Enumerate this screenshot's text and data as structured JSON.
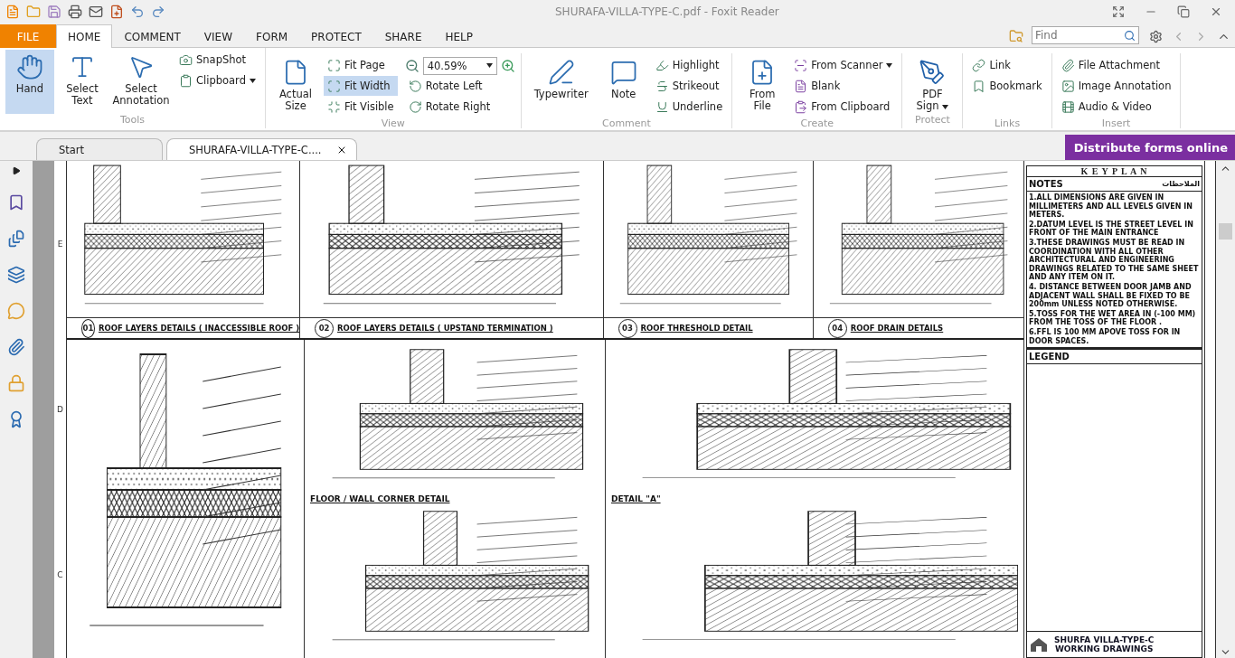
{
  "window": {
    "title": "SHURAFA-VILLA-TYPE-C.pdf - Foxit Reader"
  },
  "menu_tabs": [
    {
      "label": "FILE",
      "kind": "file",
      "selected": false
    },
    {
      "label": "HOME",
      "kind": "tab",
      "selected": true
    },
    {
      "label": "COMMENT",
      "kind": "tab",
      "selected": false
    },
    {
      "label": "VIEW",
      "kind": "tab",
      "selected": false
    },
    {
      "label": "FORM",
      "kind": "tab",
      "selected": false
    },
    {
      "label": "PROTECT",
      "kind": "tab",
      "selected": false
    },
    {
      "label": "SHARE",
      "kind": "tab",
      "selected": false
    },
    {
      "label": "HELP",
      "kind": "tab",
      "selected": false
    }
  ],
  "search": {
    "placeholder": "Find"
  },
  "ribbon": [
    {
      "label": "Tools",
      "items": [
        {
          "kind": "large",
          "label": "Hand",
          "selected": true
        },
        {
          "kind": "large",
          "label": "Select Text",
          "selected": false
        },
        {
          "kind": "large",
          "label": "Select Annotation",
          "selected": false
        },
        {
          "kind": "small",
          "label": "SnapShot",
          "selected": false
        },
        {
          "kind": "small",
          "label": "Clipboard",
          "selected": false,
          "dropdown": true
        }
      ]
    },
    {
      "label": "View",
      "items": [
        {
          "kind": "large",
          "label": "Actual Size",
          "selected": false
        },
        {
          "kind": "small",
          "label": "Fit Page",
          "selected": false
        },
        {
          "kind": "small",
          "label": "Fit Width",
          "selected": true
        },
        {
          "kind": "small",
          "label": "Fit Visible",
          "selected": false
        },
        {
          "kind": "zoom",
          "label": "40.59%"
        },
        {
          "kind": "small",
          "label": "Rotate Left",
          "selected": false
        },
        {
          "kind": "small",
          "label": "Rotate Right",
          "selected": false
        }
      ]
    },
    {
      "label": "Comment",
      "items": [
        {
          "kind": "large",
          "label": "Typewriter",
          "selected": false
        },
        {
          "kind": "large",
          "label": "Note",
          "selected": false
        },
        {
          "kind": "small",
          "label": "Highlight",
          "selected": false
        },
        {
          "kind": "small",
          "label": "Strikeout",
          "selected": false
        },
        {
          "kind": "small",
          "label": "Underline",
          "selected": false
        }
      ]
    },
    {
      "label": "Create",
      "items": [
        {
          "kind": "large",
          "label": "From File",
          "selected": false
        },
        {
          "kind": "small",
          "label": "From Scanner",
          "selected": false,
          "dropdown": true
        },
        {
          "kind": "small",
          "label": "Blank",
          "selected": false
        },
        {
          "kind": "small",
          "label": "From Clipboard",
          "selected": false
        }
      ]
    },
    {
      "label": "Protect",
      "items": [
        {
          "kind": "large",
          "label": "PDF Sign",
          "selected": false,
          "dropdown": true
        }
      ]
    },
    {
      "label": "Links",
      "items": [
        {
          "kind": "small",
          "label": "Link",
          "selected": false
        },
        {
          "kind": "small",
          "label": "Bookmark",
          "selected": false
        }
      ]
    },
    {
      "label": "Insert",
      "items": [
        {
          "kind": "small",
          "label": "File Attachment",
          "selected": false
        },
        {
          "kind": "small",
          "label": "Image Annotation",
          "selected": false
        },
        {
          "kind": "small",
          "label": "Audio & Video",
          "selected": false
        }
      ]
    }
  ],
  "doc_tabs": [
    {
      "label": "Start",
      "selected": false,
      "closable": false
    },
    {
      "label": "SHURAFA-VILLA-TYPE-C....",
      "selected": true,
      "closable": true
    }
  ],
  "promo": "Distribute forms online",
  "drawing": {
    "row_marks": [
      "E",
      "D",
      "C"
    ],
    "top_details": [
      {
        "number": "01",
        "title": "ROOF LAYERS DETAILS ( INACCESSIBLE ROOF )"
      },
      {
        "number": "02",
        "title": "ROOF LAYERS DETAILS ( UPSTAND TERMINATION )"
      },
      {
        "number": "03",
        "title": "ROOF THRESHOLD DETAIL"
      },
      {
        "number": "04",
        "title": "ROOF DRAIN DETAILS"
      }
    ],
    "bottom_details": [
      {
        "title": "FLOOR / WALL CORNER DETAIL"
      },
      {
        "title": "DETAIL \"A\""
      }
    ],
    "keyplan": "K E Y P L A N",
    "notes_title": "NOTES",
    "notes_title_ar": "الملاحظات",
    "notes": [
      "1.ALL DIMENSIONS ARE GIVEN IN MILLIMETERS AND ALL LEVELS GIVEN IN METERS.",
      "2.DATUM LEVEL IS THE STREET LEVEL IN FRONT OF THE MAIN ENTRANCE",
      "3.THESE DRAWINGS MUST BE READ IN COORDINATION WITH ALL OTHER ARCHITECTURAL AND ENGINEERING DRAWINGS RELATED TO THE SAME SHEET AND ANY ITEM ON IT.",
      "4. DISTANCE BETWEEN DOOR JAMB AND ADJACENT WALL SHALL BE FIXED TO BE 200mm UNLESS NOTED OTHERWISE.",
      "5.TOSS FOR THE WET AREA IN (-100 MM) FROM THE TOSS OF THE FLOOR .",
      "6.FFL IS 100 MM APOVE TOSS FOR IN DOOR SPACES."
    ],
    "legend_title": "LEGEND",
    "project_title": "SHURFA VILLA-TYPE-C",
    "project_subtitle": "WORKING DRAWINGS"
  }
}
